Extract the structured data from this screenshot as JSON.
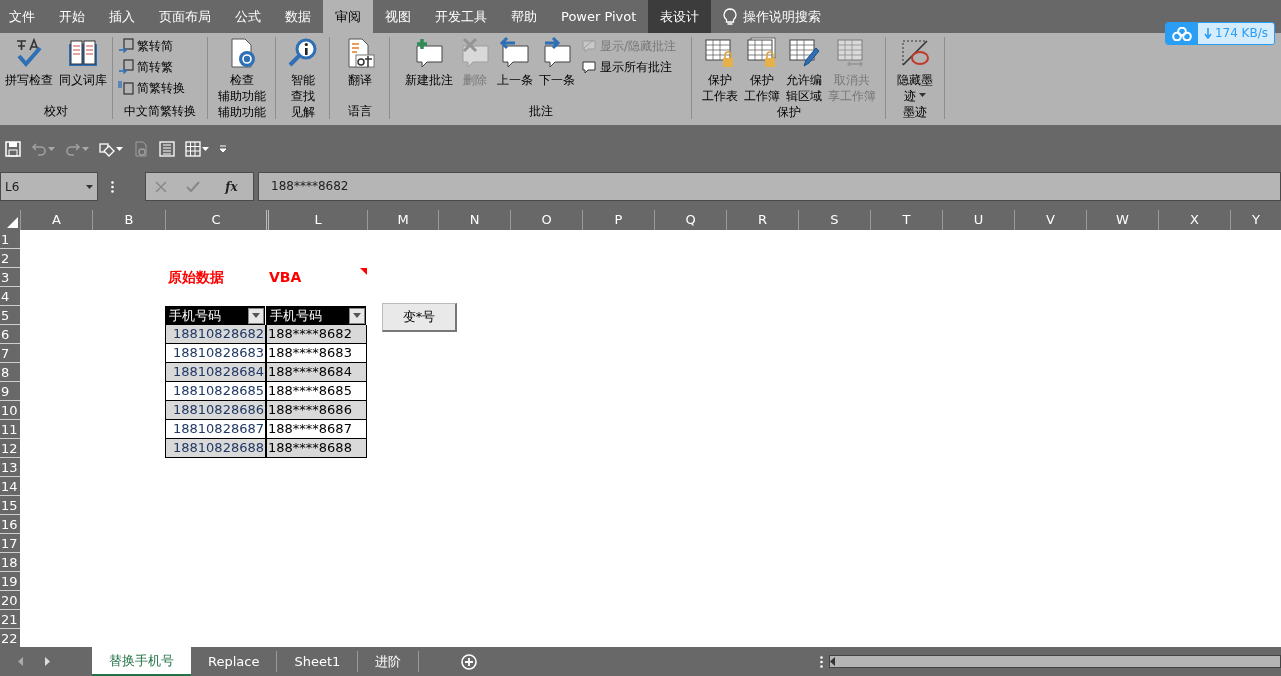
{
  "ribbon_tabs": [
    {
      "label": "文件",
      "selected": false,
      "kind": "normal"
    },
    {
      "label": "开始",
      "selected": false,
      "kind": "normal"
    },
    {
      "label": "插入",
      "selected": false,
      "kind": "normal"
    },
    {
      "label": "页面布局",
      "selected": false,
      "kind": "normal"
    },
    {
      "label": "公式",
      "selected": false,
      "kind": "normal"
    },
    {
      "label": "数据",
      "selected": false,
      "kind": "normal"
    },
    {
      "label": "审阅",
      "selected": true,
      "kind": "normal"
    },
    {
      "label": "视图",
      "selected": false,
      "kind": "normal"
    },
    {
      "label": "开发工具",
      "selected": false,
      "kind": "normal"
    },
    {
      "label": "帮助",
      "selected": false,
      "kind": "normal"
    },
    {
      "label": "Power Pivot",
      "selected": false,
      "kind": "normal"
    },
    {
      "label": "表设计",
      "selected": false,
      "kind": "contextual"
    }
  ],
  "tell_me": {
    "label": "操作说明搜索"
  },
  "download_badge": {
    "speed": "174 KB/s"
  },
  "ribbon_groups": [
    {
      "label": "校对",
      "large_buttons": [
        {
          "label": [
            "拼写检查"
          ],
          "disabled": false,
          "dropdown": false
        },
        {
          "label": [
            "同义词库"
          ],
          "disabled": false,
          "dropdown": false
        }
      ]
    },
    {
      "label": "中文简繁转换",
      "small_buttons": [
        {
          "label": "繁转简",
          "disabled": false
        },
        {
          "label": "简转繁",
          "disabled": false
        },
        {
          "label": "简繁转换",
          "disabled": false
        }
      ]
    },
    {
      "label": "辅助功能",
      "large_buttons": [
        {
          "label": [
            "检查",
            "辅助功能"
          ],
          "disabled": false,
          "dropdown": false
        }
      ]
    },
    {
      "label": "见解",
      "large_buttons": [
        {
          "label": [
            "智能",
            "查找"
          ],
          "disabled": false,
          "dropdown": false
        }
      ]
    },
    {
      "label": "语言",
      "large_buttons": [
        {
          "label": [
            "翻译"
          ],
          "disabled": false,
          "dropdown": false
        }
      ]
    },
    {
      "label": "批注",
      "large_buttons": [
        {
          "label": [
            "新建批注"
          ],
          "disabled": false,
          "dropdown": false
        },
        {
          "label": [
            "删除"
          ],
          "disabled": true,
          "dropdown": false
        },
        {
          "label": [
            "上一条"
          ],
          "disabled": false,
          "dropdown": false
        },
        {
          "label": [
            "下一条"
          ],
          "disabled": false,
          "dropdown": false
        }
      ],
      "small_buttons": [
        {
          "label": "显示/隐藏批注",
          "disabled": true
        },
        {
          "label": "显示所有批注",
          "disabled": false
        }
      ]
    },
    {
      "label": "保护",
      "large_buttons": [
        {
          "label": [
            "保护",
            "工作表"
          ],
          "disabled": false,
          "dropdown": false
        },
        {
          "label": [
            "保护",
            "工作簿"
          ],
          "disabled": false,
          "dropdown": false
        },
        {
          "label": [
            "允许编",
            "辑区域"
          ],
          "disabled": false,
          "dropdown": false
        },
        {
          "label": [
            "取消共",
            "享工作簿"
          ],
          "disabled": true,
          "dropdown": false
        }
      ]
    },
    {
      "label": "墨迹",
      "large_buttons": [
        {
          "label": [
            "隐藏墨",
            "迹"
          ],
          "disabled": false,
          "dropdown": true
        }
      ]
    }
  ],
  "quick_access": [
    {
      "disabled": false,
      "dropdown": false
    },
    {
      "disabled": true,
      "dropdown": true
    },
    {
      "disabled": true,
      "dropdown": true
    },
    {
      "disabled": false,
      "dropdown": true
    },
    {
      "disabled": true,
      "dropdown": false
    },
    {
      "disabled": false,
      "dropdown": false
    },
    {
      "disabled": false,
      "dropdown": true
    }
  ],
  "formula_bar": {
    "name_box": "L6",
    "function_label": "fx",
    "formula": "188****8682"
  },
  "column_headers": [
    "A",
    "B",
    "C",
    "L",
    "M",
    "N",
    "O",
    "P",
    "Q",
    "R",
    "S",
    "T",
    "U",
    "V",
    "W",
    "X",
    "Y"
  ],
  "row_headers": [
    "1",
    "2",
    "3",
    "4",
    "5",
    "6",
    "7",
    "8",
    "9",
    "10",
    "11",
    "12",
    "13",
    "14",
    "15",
    "16",
    "17",
    "18",
    "19",
    "20",
    "21",
    "22"
  ],
  "cells": [
    {
      "text": "原始数据",
      "comment": false
    },
    {
      "text": "VBA",
      "comment": true
    }
  ],
  "table": {
    "columns": [
      "手机号码",
      "手机号码"
    ],
    "rows": [
      [
        "18810828682",
        "188****8682"
      ],
      [
        "18810828683",
        "188****8683"
      ],
      [
        "18810828684",
        "188****8684"
      ],
      [
        "18810828685",
        "188****8685"
      ],
      [
        "18810828686",
        "188****8686"
      ],
      [
        "18810828687",
        "188****8687"
      ],
      [
        "18810828688",
        "188****8688"
      ]
    ]
  },
  "sheet_button": {
    "label": "变*号"
  },
  "sheet_tabs": [
    {
      "label": "替换手机号",
      "selected": true
    },
    {
      "label": "Replace",
      "selected": false
    },
    {
      "label": "Sheet1",
      "selected": false
    },
    {
      "label": "进阶",
      "selected": false
    }
  ]
}
